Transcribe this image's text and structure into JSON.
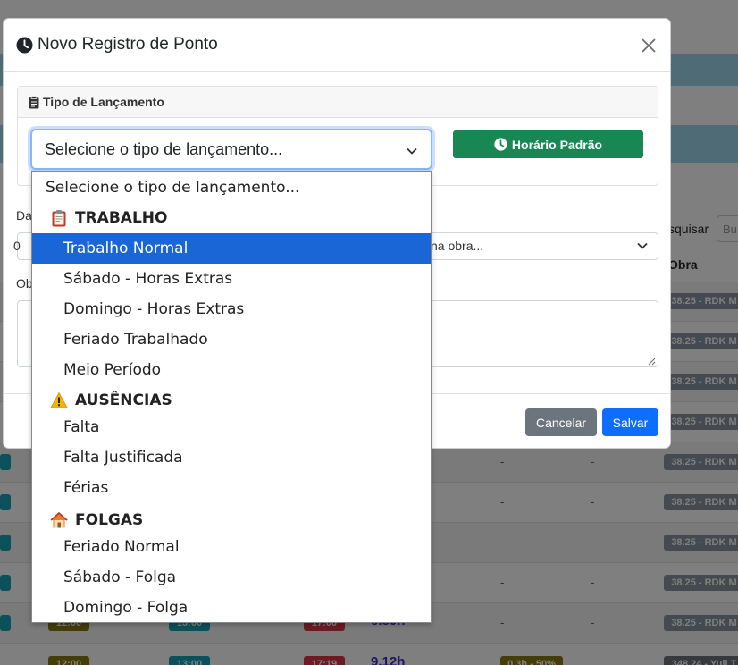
{
  "modal": {
    "title": "Novo Registro de Ponto",
    "card_title": "Tipo de Lançamento",
    "select_value": "Selecione o tipo de lançamento...",
    "horario_padrao_label": "Horário Padrão",
    "date_label_fragment": "Da",
    "obs_label_fragment": "Ob",
    "obra_value_fragment": "na obra...",
    "obra_first_fragment": "0",
    "cancel_label": "Cancelar",
    "save_label": "Salvar"
  },
  "dropdown": {
    "placeholder": "Selecione o tipo de lançamento...",
    "groups": [
      {
        "label": "TRABALHO",
        "icon": "clipboard-icon",
        "options": [
          "Trabalho Normal",
          "Sábado - Horas Extras",
          "Domingo - Horas Extras",
          "Feriado Trabalhado",
          "Meio Período"
        ]
      },
      {
        "label": "AUSÊNCIAS",
        "icon": "warning-icon",
        "options": [
          "Falta",
          "Falta Justificada",
          "Férias"
        ]
      },
      {
        "label": "FOLGAS",
        "icon": "house-icon",
        "options": [
          "Feriado Normal",
          "Sábado - Folga",
          "Domingo - Folga"
        ]
      }
    ],
    "selected": "Trabalho Normal"
  },
  "background": {
    "search_label": "squisar",
    "search_placeholder": "Bu",
    "obra_header": "Obra",
    "obra_tag": "38.25 - RDK M",
    "obra_tag_alt": "348.24 - Yull T",
    "dash": "-",
    "row_times": [
      "12:00",
      "13:00",
      "17:00",
      "17:19"
    ],
    "row_hours": [
      "8.80h",
      "9.12h"
    ],
    "extra_tag": "0.3h - 50%"
  },
  "colors": {
    "primary": "#0d6efd",
    "success": "#198754",
    "secondary": "#6c757d",
    "selected_option": "#1a66d6"
  }
}
